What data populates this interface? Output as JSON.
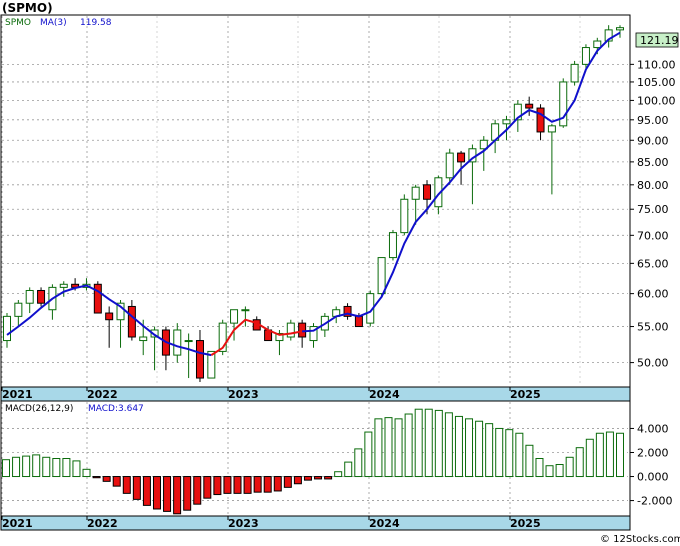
{
  "chart_data": [
    {
      "type": "candlestick",
      "title": "(SPMO)",
      "ticker_label": "SPMO",
      "ma_label": "MA(3)",
      "ma_value": "119.58",
      "last_price": "121.19",
      "y_scale": "log",
      "ylim": [
        47,
        125
      ],
      "yticks": [
        "110.00",
        "105.00",
        "100.00",
        "95.00",
        "90.00",
        "85.00",
        "80.00",
        "75.00",
        "70.00",
        "65.00",
        "60.00",
        "55.00",
        "50.00"
      ],
      "x_labels": [
        "2021",
        "2022",
        "2023",
        "2024",
        "2025"
      ],
      "grid": true,
      "colors": {
        "up": "#0b6b0b",
        "down": "#e81010",
        "ma_up": "#1010cc",
        "ma_down": "#e81010",
        "last_bg": "#c8f0c8",
        "axis_band": "#a8d8e8"
      },
      "candles": [
        [
          53,
          57,
          52,
          56.5
        ],
        [
          56.5,
          59,
          55,
          58.5
        ],
        [
          58.5,
          61,
          57,
          60.5
        ],
        [
          60.5,
          61,
          58,
          58.5
        ],
        [
          57.5,
          61.5,
          56,
          61
        ],
        [
          61,
          62,
          59.5,
          61.5
        ],
        [
          61.5,
          62.5,
          60.5,
          61
        ],
        [
          61,
          62.5,
          60.5,
          61.5
        ],
        [
          61.5,
          62,
          57,
          57
        ],
        [
          57,
          58,
          52,
          56
        ],
        [
          56,
          59,
          52,
          58.5
        ],
        [
          58,
          59,
          53,
          53.5
        ],
        [
          53,
          56,
          51,
          53.5
        ],
        [
          53.5,
          55,
          49,
          54.5
        ],
        [
          54.5,
          55,
          49,
          51
        ],
        [
          51,
          55.5,
          50,
          54.5
        ],
        [
          53,
          54,
          48,
          53
        ],
        [
          53,
          54.5,
          47.5,
          48
        ],
        [
          48,
          51.5,
          48.5,
          51.5
        ],
        [
          51.5,
          56,
          51,
          55.5
        ],
        [
          55.5,
          57.5,
          53,
          57.5
        ],
        [
          57.5,
          58,
          55,
          57.5
        ],
        [
          56,
          56.5,
          55,
          54.5
        ],
        [
          54.5,
          55,
          53,
          53
        ],
        [
          53,
          54.5,
          51,
          54
        ],
        [
          53.5,
          56,
          53,
          55.5
        ],
        [
          55.5,
          56,
          52,
          53.5
        ],
        [
          53,
          55.5,
          52,
          55
        ],
        [
          54.5,
          57,
          53.5,
          56.5
        ],
        [
          56.5,
          58,
          55.5,
          57.5
        ],
        [
          58,
          58.5,
          56,
          56.5
        ],
        [
          56.5,
          57,
          55,
          55
        ],
        [
          55.5,
          60.5,
          55,
          60
        ],
        [
          60,
          66,
          59.5,
          66
        ],
        [
          66,
          71,
          65.5,
          70.5
        ],
        [
          70.5,
          78,
          70,
          77
        ],
        [
          77,
          80,
          72,
          79.5
        ],
        [
          80,
          81,
          74,
          77
        ],
        [
          75.5,
          82,
          74,
          81.5
        ],
        [
          81.5,
          88,
          80,
          87
        ],
        [
          87,
          87.5,
          80,
          85
        ],
        [
          85,
          89,
          76,
          88
        ],
        [
          88,
          91,
          83,
          90
        ],
        [
          90,
          95,
          87,
          94
        ],
        [
          94,
          96,
          90,
          95
        ],
        [
          95,
          100,
          92,
          99
        ],
        [
          99,
          101,
          96,
          98
        ],
        [
          98,
          99,
          90,
          92
        ],
        [
          92,
          94,
          78,
          93.5
        ],
        [
          93.5,
          106,
          93,
          105
        ],
        [
          105,
          111,
          104,
          110
        ],
        [
          110,
          116,
          108,
          115
        ],
        [
          115,
          118,
          113,
          117
        ],
        [
          117,
          122,
          115,
          120.5
        ],
        [
          120.5,
          122,
          118,
          121.2
        ]
      ],
      "ma": [
        53.8,
        55.0,
        56.3,
        57.8,
        59.2,
        60.3,
        60.9,
        61.3,
        60.4,
        59.1,
        58.0,
        56.5,
        55.1,
        53.8,
        52.8,
        52.2,
        51.8,
        51.3,
        51.0,
        52.0,
        54.5,
        56.0,
        55.5,
        54.5,
        53.8,
        54.0,
        54.3,
        54.4,
        55.4,
        56.5,
        56.9,
        56.5,
        57.2,
        59.5,
        63.5,
        68.5,
        72.5,
        75.0,
        78.0,
        80.5,
        83.5,
        85.8,
        87.5,
        90.0,
        92.5,
        95.5,
        97.5,
        96.5,
        94.5,
        95.5,
        100.0,
        108.5,
        114.0,
        117.5,
        119.6
      ],
      "ma_color_split": [
        [
          0,
          18,
          "up"
        ],
        [
          18,
          26,
          "down"
        ],
        [
          26,
          54,
          "up"
        ]
      ]
    },
    {
      "type": "bar",
      "title": "MACD(26,12,9)",
      "series_name": "MACD:3.647",
      "ylim": [
        -3.2,
        6.2
      ],
      "yticks": [
        "4.000",
        "2.000",
        "0.000",
        "-2.000"
      ],
      "x_labels": [
        "2021",
        "2022",
        "2023",
        "2024",
        "2025"
      ],
      "values": [
        1.4,
        1.6,
        1.7,
        1.8,
        1.6,
        1.5,
        1.5,
        1.3,
        0.6,
        -0.1,
        -0.4,
        -0.8,
        -1.4,
        -1.9,
        -2.4,
        -2.7,
        -2.9,
        -3.1,
        -2.8,
        -2.3,
        -1.8,
        -1.5,
        -1.4,
        -1.4,
        -1.4,
        -1.3,
        -1.3,
        -1.2,
        -0.9,
        -0.6,
        -0.3,
        -0.2,
        -0.2,
        0.4,
        1.2,
        2.3,
        3.7,
        4.8,
        4.9,
        4.8,
        5.2,
        5.6,
        5.6,
        5.5,
        5.3,
        5.0,
        4.8,
        4.6,
        4.4,
        4.0,
        3.9,
        3.6,
        2.6,
        1.5,
        0.9,
        1.0,
        1.6,
        2.4,
        3.1,
        3.6,
        3.7,
        3.6
      ],
      "colors": {
        "pos": "#0b6b0b",
        "neg": "#e81010",
        "label": "#1010cc"
      }
    }
  ],
  "watermark": "© 12Stocks.com"
}
